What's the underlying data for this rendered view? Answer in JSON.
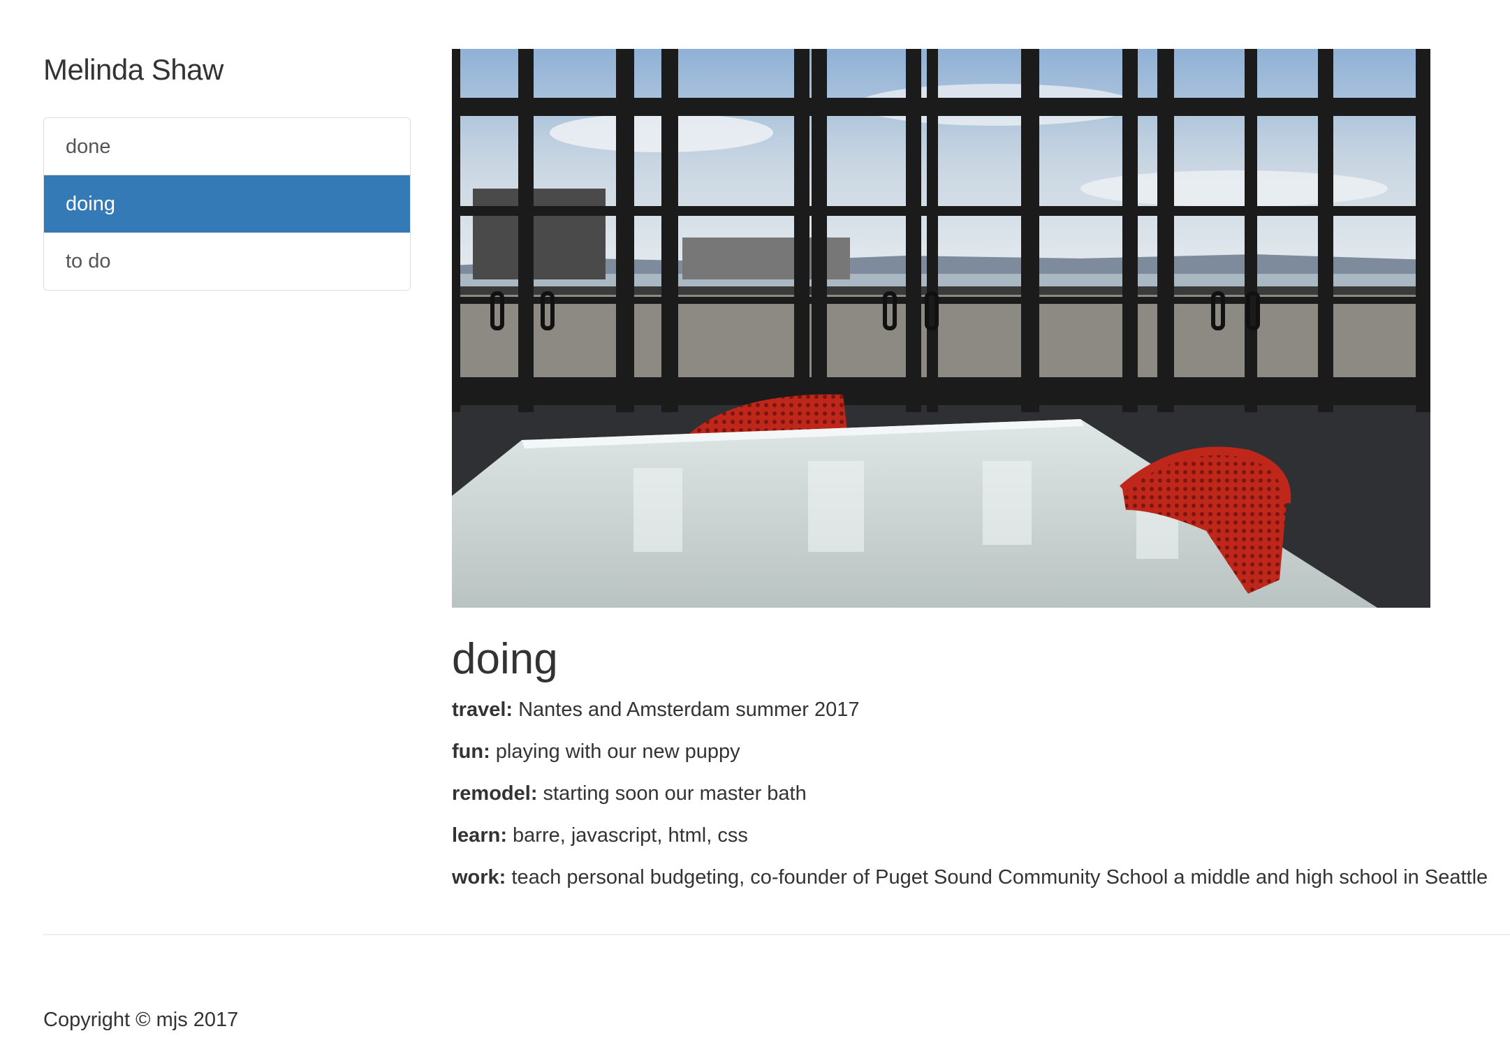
{
  "site": {
    "title": "Melinda Shaw"
  },
  "nav": {
    "items": [
      {
        "label": "done",
        "active": false
      },
      {
        "label": "doing",
        "active": true
      },
      {
        "label": "to do",
        "active": false
      }
    ]
  },
  "main": {
    "heading": "doing",
    "facts": [
      {
        "key": "travel:",
        "value": " Nantes and Amsterdam summer 2017"
      },
      {
        "key": "fun:",
        "value": " playing with our new puppy"
      },
      {
        "key": "remodel:",
        "value": " starting soon our master bath"
      },
      {
        "key": "learn:",
        "value": " barre, javascript, html, css"
      },
      {
        "key": "work:",
        "value": " teach personal budgeting, co-founder of Puget Sound Community School a middle and high school in Seattle"
      }
    ]
  },
  "footer": {
    "copyright": "Copyright © mjs 2017"
  },
  "colors": {
    "accent": "#337ab7",
    "chair": "#c0271b"
  }
}
